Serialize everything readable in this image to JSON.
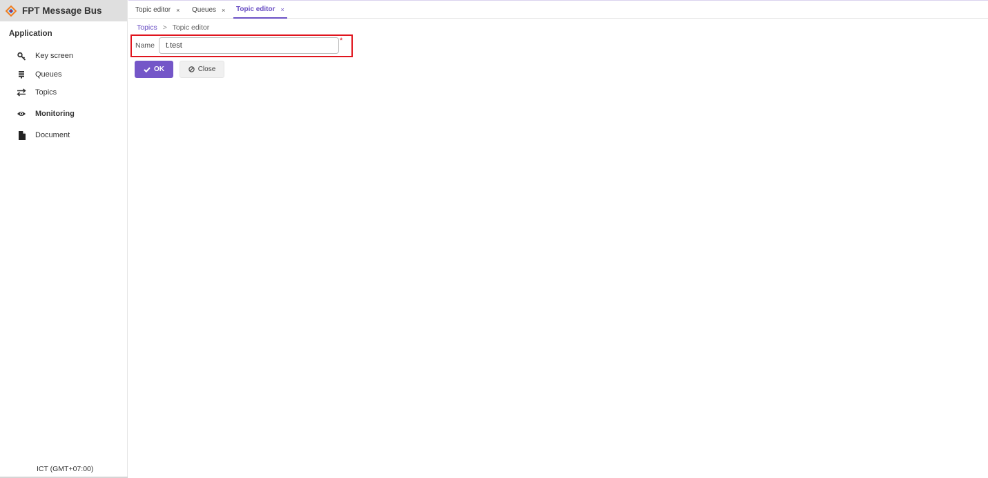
{
  "app": {
    "title": "FPT Message Bus",
    "section_label": "Application",
    "timezone": "ICT (GMT+07:00)"
  },
  "sidebar": {
    "items": [
      {
        "label": "Key screen",
        "icon": "key-icon"
      },
      {
        "label": "Queues",
        "icon": "stack-icon"
      },
      {
        "label": "Topics",
        "icon": "exchange-arrows-icon"
      },
      {
        "label": "Monitoring",
        "icon": "eye-icon"
      },
      {
        "label": "Document",
        "icon": "file-icon"
      }
    ]
  },
  "tabs": [
    {
      "label": "Topic editor",
      "close": "×",
      "active": false
    },
    {
      "label": "Queues",
      "close": "×",
      "active": false
    },
    {
      "label": "Topic editor",
      "close": "×",
      "active": true
    }
  ],
  "breadcrumb": {
    "parent": "Topics",
    "separator": ">",
    "current": "Topic editor"
  },
  "form": {
    "name_label": "Name",
    "name_value": "t.test",
    "required_mark": "*"
  },
  "buttons": {
    "ok_label": "OK",
    "close_label": "Close"
  },
  "colors": {
    "accent": "#7456c8",
    "highlight_border": "#e0141d"
  }
}
